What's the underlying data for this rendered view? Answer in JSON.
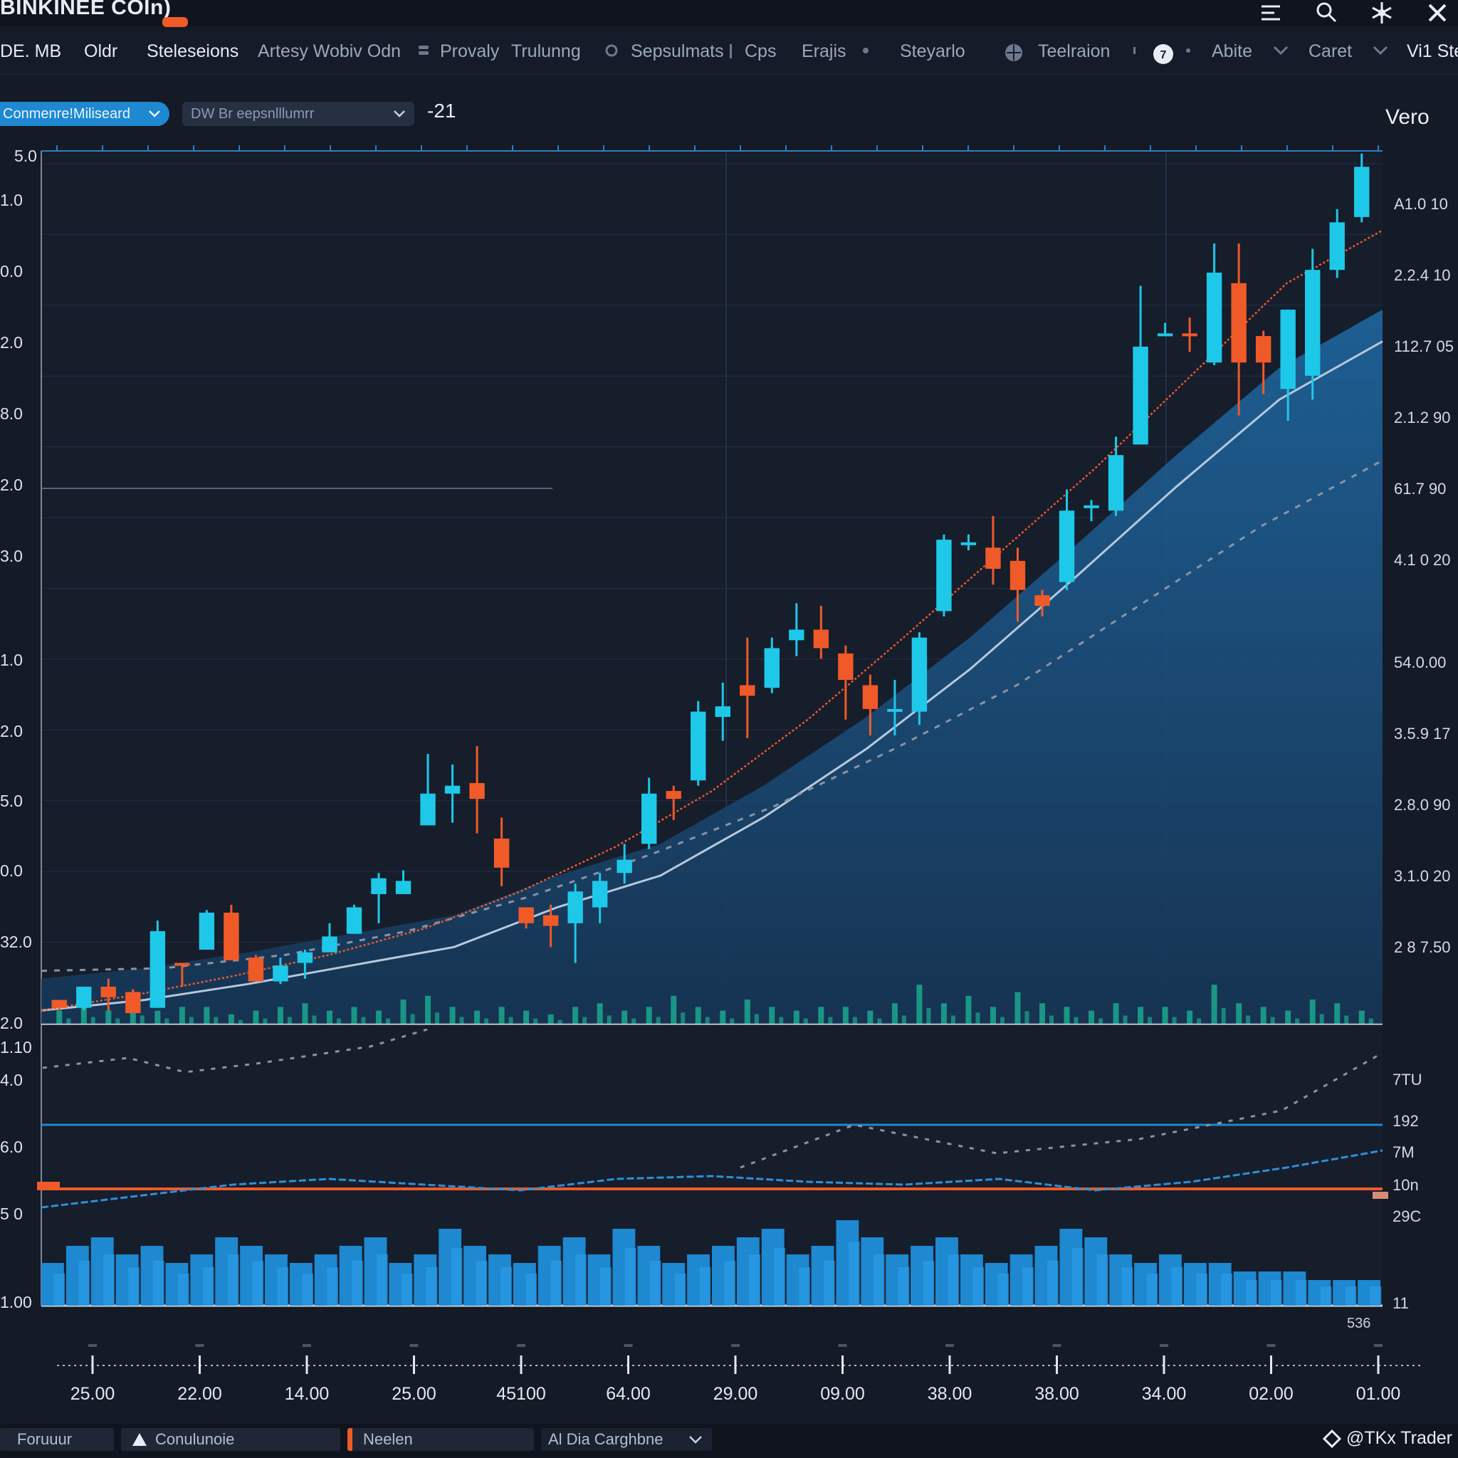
{
  "window": {
    "title": "BINKINEE COIn)"
  },
  "menubar": {
    "items": [
      "DE. MB",
      "Oldr",
      "Steleseions",
      "Artesy Wobiv Odn",
      "Provaly",
      "Trulunng",
      "Sepsulmats",
      "Cps",
      "Erajis",
      "Steyarlo",
      "Teelraion",
      "Abite",
      "Caret",
      "Vi1 Ste"
    ]
  },
  "toolbar": {
    "primary_select": "Conmenre!Miliseard",
    "secondary_select": "DW Br eepsnlllumrr",
    "value": "-21"
  },
  "chart_label": "Vero",
  "y_axis_left_main": [
    "1.0",
    "0.0",
    "2.0",
    "8.0",
    "2.0",
    "3.0",
    "1.0",
    "2.0",
    "5.0",
    "0.0",
    "32.0",
    "2.0"
  ],
  "y_axis_left_top": "5.0",
  "y_axis_right_main": [
    "A1.0 10",
    "2.2.4 10",
    "112.7 05",
    "2.1.2 90",
    "61.7 90",
    "4.1 0 20",
    "54.0.00",
    "3.5.9 17",
    "2.8.0 90",
    "3.1.0 20",
    "2 8 7.50"
  ],
  "y_axis_left_sub": [
    "1.10",
    "4.0",
    "6.0",
    "5 0",
    "1.00"
  ],
  "y_axis_right_sub": [
    "7TU",
    "192",
    "7M",
    "10n",
    "29C",
    "11"
  ],
  "x_axis": [
    "25.00",
    "22.00",
    "14.00",
    "25.00",
    "45100",
    "64.00",
    "29.00",
    "09.00",
    "38.00",
    "38.00",
    "34.00",
    "02.00",
    "01.00"
  ],
  "corner_value": "536",
  "status": {
    "tabs": [
      "Foruuur",
      "Conulunoie",
      "Neelen",
      "Al Dia Carghbne"
    ],
    "brand": "@TKx Trader"
  },
  "colors": {
    "bullish": "#1ec8e8",
    "bearish": "#f05a28",
    "area": "#1f5c90",
    "ma_light": "#b6c8dc",
    "ma_trend": "#f05a28",
    "volume": "#1aa88e",
    "osc_bar": "#1e88d0"
  },
  "chart_data": {
    "type": "candlestick",
    "candles": [
      {
        "o": 9.9,
        "c": 9.6,
        "h": 9.9,
        "l": 9.5
      },
      {
        "o": 9.6,
        "c": 10.4,
        "h": 10.4,
        "l": 9.5
      },
      {
        "o": 10.4,
        "c": 10.0,
        "h": 10.7,
        "l": 9.5
      },
      {
        "o": 10.2,
        "c": 9.4,
        "h": 10.3,
        "l": 9.4
      },
      {
        "o": 9.6,
        "c": 12.5,
        "h": 12.9,
        "l": 9.6
      },
      {
        "o": 11.3,
        "c": 11.2,
        "h": 11.3,
        "l": 10.4
      },
      {
        "o": 11.8,
        "c": 13.2,
        "h": 13.3,
        "l": 11.8
      },
      {
        "o": 13.2,
        "c": 11.4,
        "h": 13.5,
        "l": 11.5
      },
      {
        "o": 11.5,
        "c": 10.6,
        "h": 11.6,
        "l": 10.6
      },
      {
        "o": 10.6,
        "c": 11.2,
        "h": 11.5,
        "l": 10.5
      },
      {
        "o": 11.3,
        "c": 11.7,
        "h": 11.8,
        "l": 10.7
      },
      {
        "o": 11.7,
        "c": 12.3,
        "h": 12.8,
        "l": 11.7
      },
      {
        "o": 12.4,
        "c": 13.4,
        "h": 13.5,
        "l": 12.4
      },
      {
        "o": 13.9,
        "c": 14.5,
        "h": 14.7,
        "l": 12.8
      },
      {
        "o": 13.9,
        "c": 14.4,
        "h": 14.8,
        "l": 13.9
      },
      {
        "o": 16.5,
        "c": 17.7,
        "h": 19.2,
        "l": 16.5
      },
      {
        "o": 17.7,
        "c": 18.0,
        "h": 18.8,
        "l": 16.6
      },
      {
        "o": 18.1,
        "c": 17.5,
        "h": 19.5,
        "l": 16.2
      },
      {
        "o": 16.0,
        "c": 14.9,
        "h": 16.8,
        "l": 14.2
      },
      {
        "o": 13.4,
        "c": 12.8,
        "h": 13.4,
        "l": 12.6
      },
      {
        "o": 13.1,
        "c": 12.7,
        "h": 13.5,
        "l": 11.9
      },
      {
        "o": 12.8,
        "c": 14.0,
        "h": 14.3,
        "l": 11.3
      },
      {
        "o": 13.4,
        "c": 14.4,
        "h": 14.7,
        "l": 12.8
      },
      {
        "o": 14.7,
        "c": 15.2,
        "h": 15.8,
        "l": 14.3
      },
      {
        "o": 15.8,
        "c": 17.7,
        "h": 18.3,
        "l": 15.6
      },
      {
        "o": 17.8,
        "c": 17.5,
        "h": 18.0,
        "l": 16.7
      },
      {
        "o": 18.2,
        "c": 20.8,
        "h": 21.2,
        "l": 18.0
      },
      {
        "o": 20.6,
        "c": 21.0,
        "h": 21.9,
        "l": 19.7
      },
      {
        "o": 21.8,
        "c": 21.4,
        "h": 23.6,
        "l": 19.8
      },
      {
        "o": 21.7,
        "c": 23.2,
        "h": 23.6,
        "l": 21.5
      },
      {
        "o": 23.5,
        "c": 23.9,
        "h": 24.9,
        "l": 22.9
      },
      {
        "o": 23.9,
        "c": 23.2,
        "h": 24.8,
        "l": 22.8
      },
      {
        "o": 23.0,
        "c": 22.0,
        "h": 23.3,
        "l": 20.5
      },
      {
        "o": 21.8,
        "c": 20.9,
        "h": 22.2,
        "l": 19.9
      },
      {
        "o": 20.9,
        "c": 20.9,
        "h": 22.0,
        "l": 19.9
      },
      {
        "o": 20.8,
        "c": 23.6,
        "h": 23.8,
        "l": 20.3
      },
      {
        "o": 24.6,
        "c": 27.3,
        "h": 27.5,
        "l": 24.4
      },
      {
        "o": 27.2,
        "c": 27.2,
        "h": 27.5,
        "l": 26.9
      },
      {
        "o": 27.0,
        "c": 26.2,
        "h": 28.2,
        "l": 25.6
      },
      {
        "o": 26.5,
        "c": 25.4,
        "h": 27.0,
        "l": 24.2
      },
      {
        "o": 25.2,
        "c": 24.8,
        "h": 25.4,
        "l": 24.4
      },
      {
        "o": 25.7,
        "c": 28.4,
        "h": 29.2,
        "l": 25.4
      },
      {
        "o": 28.6,
        "c": 28.6,
        "h": 28.8,
        "l": 28.0
      },
      {
        "o": 28.4,
        "c": 30.5,
        "h": 31.2,
        "l": 28.2
      },
      {
        "o": 30.9,
        "c": 34.6,
        "h": 36.9,
        "l": 30.9
      },
      {
        "o": 35.1,
        "c": 35.1,
        "h": 35.5,
        "l": 35.0
      },
      {
        "o": 35.1,
        "c": 35.0,
        "h": 35.7,
        "l": 34.4
      },
      {
        "o": 34.0,
        "c": 37.4,
        "h": 38.5,
        "l": 33.9
      },
      {
        "o": 37.0,
        "c": 34.0,
        "h": 38.5,
        "l": 32.0
      },
      {
        "o": 35.0,
        "c": 34.0,
        "h": 35.2,
        "l": 32.8
      },
      {
        "o": 33.0,
        "c": 36.0,
        "h": 36.0,
        "l": 31.8
      },
      {
        "o": 33.5,
        "c": 37.5,
        "h": 38.3,
        "l": 32.6
      },
      {
        "o": 37.5,
        "c": 39.3,
        "h": 39.8,
        "l": 37.2
      },
      {
        "o": 39.5,
        "c": 41.4,
        "h": 41.9,
        "l": 39.3
      }
    ],
    "trend_line": [
      9.5,
      10.1,
      10.8,
      11.6,
      12.6,
      14.0,
      15.7,
      17.8,
      20.5,
      23.6,
      26.8,
      30.0,
      33.5,
      37.0,
      39.0
    ],
    "ma_light": [
      9.5,
      9.9,
      10.5,
      11.2,
      11.9,
      13.4,
      14.6,
      16.8,
      19.4,
      22.4,
      25.8,
      29.3,
      32.6,
      34.8
    ],
    "ma_dashed": [
      11.0,
      11.1,
      11.6,
      12.5,
      13.8,
      15.4,
      17.2,
      19.4,
      21.8,
      24.8,
      27.8,
      30.3
    ],
    "volume": [
      0.2,
      0.3,
      0.2,
      0.4,
      0.2,
      0.3,
      0.3,
      0.1,
      0.2,
      0.3,
      0.4,
      0.2,
      0.3,
      0.2,
      0.5,
      0.6,
      0.3,
      0.2,
      0.3,
      0.2,
      0.1,
      0.3,
      0.4,
      0.2,
      0.3,
      0.6,
      0.3,
      0.2,
      0.5,
      0.3,
      0.2,
      0.3,
      0.3,
      0.2,
      0.4,
      0.9,
      0.4,
      0.6,
      0.3,
      0.7,
      0.4,
      0.3,
      0.2,
      0.4,
      0.3,
      0.3,
      0.2,
      0.9,
      0.4,
      0.3,
      0.2,
      0.5,
      0.4,
      0.2
    ],
    "osc_bars": [
      0.5,
      0.7,
      0.8,
      0.6,
      0.7,
      0.5,
      0.6,
      0.8,
      0.7,
      0.6,
      0.5,
      0.6,
      0.7,
      0.8,
      0.5,
      0.6,
      0.9,
      0.7,
      0.6,
      0.5,
      0.7,
      0.8,
      0.6,
      0.9,
      0.7,
      0.5,
      0.6,
      0.7,
      0.8,
      0.9,
      0.6,
      0.7,
      1.0,
      0.8,
      0.6,
      0.7,
      0.8,
      0.6,
      0.5,
      0.6,
      0.7,
      0.9,
      0.8,
      0.6,
      0.5,
      0.6,
      0.5,
      0.5,
      0.4,
      0.4,
      0.4,
      0.3,
      0.3,
      0.3
    ],
    "ylim": [
      9,
      42
    ]
  }
}
